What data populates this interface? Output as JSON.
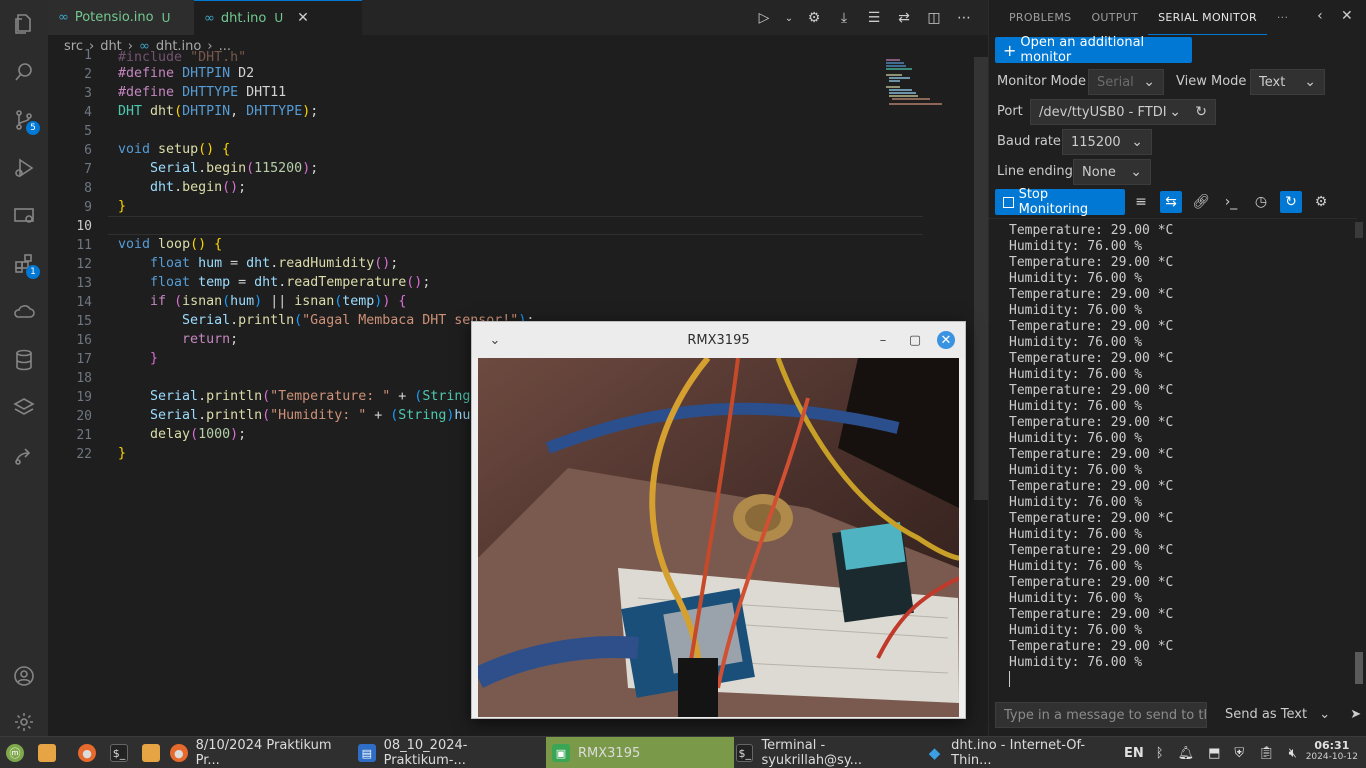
{
  "editor": {
    "tabs": [
      {
        "name": "Potensio.ino",
        "status": "U"
      },
      {
        "name": "dht.ino",
        "status": "U"
      }
    ],
    "breadcrumb": [
      "src",
      "dht",
      "dht.ino",
      "..."
    ],
    "line_numbers": [
      "1",
      "2",
      "3",
      "4",
      "5",
      "6",
      "7",
      "8",
      "9",
      "10",
      "11",
      "12",
      "13",
      "14",
      "15",
      "16",
      "17",
      "18",
      "19",
      "20",
      "21",
      "22"
    ],
    "active_line": "10"
  },
  "serial": {
    "tabs": {
      "problems": "PROBLEMS",
      "output": "OUTPUT",
      "serial_monitor": "SERIAL MONITOR",
      "more": "···"
    },
    "open_monitor": "Open an additional monitor",
    "monitor_mode_label": "Monitor Mode",
    "monitor_mode_value": "Serial",
    "view_mode_label": "View Mode",
    "view_mode_value": "Text",
    "port_label": "Port",
    "port_value": "/dev/ttyUSB0 - FTDI",
    "baud_label": "Baud rate",
    "baud_value": "115200",
    "line_ending_label": "Line ending",
    "line_ending_value": "None",
    "stop_button": "Stop Monitoring",
    "lines": [
      "Temperature: 29.00 *C",
      "Humidity: 76.00 %",
      "Temperature: 29.00 *C",
      "Humidity: 76.00 %",
      "Temperature: 29.00 *C",
      "Humidity: 76.00 %",
      "Temperature: 29.00 *C",
      "Humidity: 76.00 %",
      "Temperature: 29.00 *C",
      "Humidity: 76.00 %",
      "Temperature: 29.00 *C",
      "Humidity: 76.00 %",
      "Temperature: 29.00 *C",
      "Humidity: 76.00 %",
      "Temperature: 29.00 *C",
      "Humidity: 76.00 %",
      "Temperature: 29.00 *C",
      "Humidity: 76.00 %",
      "Temperature: 29.00 *C",
      "Humidity: 76.00 %",
      "Temperature: 29.00 *C",
      "Humidity: 76.00 %",
      "Temperature: 29.00 *C",
      "Humidity: 76.00 %",
      "Temperature: 29.00 *C",
      "Humidity: 76.00 %",
      "Temperature: 29.00 *C",
      "Humidity: 76.00 %"
    ],
    "send_placeholder": "Type in a message to send to the se",
    "send_as": "Send as Text"
  },
  "camera_window": {
    "title": "RMX3195"
  },
  "taskbar": {
    "items": [
      "8/10/2024 Praktikum Pr...",
      "08_10_2024-Praktikum-...",
      "RMX3195",
      "Terminal - syukrillah@sy...",
      "dht.ino - Internet-Of-Thin..."
    ],
    "lang": "EN",
    "time": "06:31",
    "date": "2024-10-12"
  },
  "badges": {
    "source_control": "5",
    "extensions": "1"
  }
}
